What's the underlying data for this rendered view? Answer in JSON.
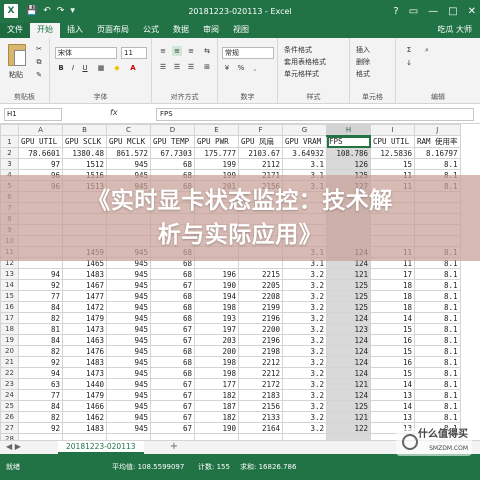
{
  "window": {
    "title": "20181223-020113 - Excel",
    "quick_access": [
      "💾",
      "↶",
      "↷",
      "▾"
    ],
    "controls": [
      "?",
      "▭",
      "—",
      "□",
      "✕"
    ]
  },
  "ribbon_tabs": [
    "文件",
    "开始",
    "插入",
    "页面布局",
    "公式",
    "数据",
    "审阅",
    "视图"
  ],
  "ribbon_active_tab": "开始",
  "user": "吃瓜 大师",
  "ribbon": {
    "clipboard": {
      "paste": "粘贴",
      "label": "剪贴板"
    },
    "font": {
      "name": "宋体",
      "size": "11",
      "label": "字体",
      "bold": "B",
      "italic": "I",
      "underline": "U",
      "grow": "A",
      "shrink": "A"
    },
    "alignment": {
      "label": "对齐方式"
    },
    "number": {
      "format": "常规",
      "label": "数字",
      "percent": "%",
      "comma": ","
    },
    "styles": {
      "conditional": "条件格式",
      "table": "套用表格格式",
      "cell": "单元格样式",
      "label": "样式"
    },
    "cells": {
      "insert": "插入",
      "delete": "删除",
      "format": "格式",
      "label": "单元格"
    },
    "editing": {
      "label": "编辑",
      "sum": "Σ",
      "sort": "↓"
    }
  },
  "formula_bar": {
    "name_box": "H1",
    "fx": "fx",
    "content": "FPS"
  },
  "grid": {
    "columns": [
      "A",
      "B",
      "C",
      "D",
      "E",
      "F",
      "G",
      "H",
      "I",
      "J"
    ],
    "selected_column": "H",
    "active_cell": "H1",
    "rows": [
      [
        "1",
        "GPU UTIL",
        "GPU SCLK",
        "GPU MCLK",
        "GPU TEMP",
        "GPU PWR",
        "GPU 风扇",
        "GPU VRAM",
        "FPS",
        "CPU UTIL",
        "RAM 使用率"
      ],
      [
        "2",
        "78.6601",
        "1380.48",
        "861.572",
        "67.7303",
        "175.777",
        "2103.67",
        "3.64932",
        "108.786",
        "12.5836",
        "8.16797"
      ],
      [
        "3",
        "97",
        "1512",
        "945",
        "68",
        "199",
        "2112",
        "3.1",
        "126",
        "15",
        "8.1"
      ],
      [
        "4",
        "96",
        "1516",
        "945",
        "68",
        "199",
        "2171",
        "3.1",
        "125",
        "11",
        "8.1"
      ],
      [
        "5",
        "96",
        "1513",
        "945",
        "68",
        "201",
        "2156",
        "3.1",
        "127",
        "11",
        "8.1"
      ],
      [
        "6",
        "",
        "",
        "",
        "",
        "",
        "",
        "",
        "",
        "",
        ""
      ],
      [
        "7",
        "",
        "",
        "",
        "",
        "",
        "",
        "",
        "",
        "",
        ""
      ],
      [
        "8",
        "",
        "",
        "",
        "",
        "",
        "",
        "",
        "",
        "",
        ""
      ],
      [
        "9",
        "",
        "",
        "",
        "",
        "",
        "",
        "",
        "",
        "",
        ""
      ],
      [
        "10",
        "",
        "",
        "",
        "",
        "",
        "",
        "",
        "",
        "",
        ""
      ],
      [
        "11",
        "",
        "1459",
        "945",
        "68",
        "",
        "",
        "3.1",
        "124",
        "11",
        "8.1"
      ],
      [
        "12",
        "",
        "1465",
        "945",
        "68",
        "",
        "",
        "3.1",
        "124",
        "11",
        "8.1"
      ],
      [
        "13",
        "94",
        "1483",
        "945",
        "68",
        "196",
        "2215",
        "3.2",
        "121",
        "17",
        "8.1"
      ],
      [
        "14",
        "92",
        "1467",
        "945",
        "67",
        "190",
        "2205",
        "3.2",
        "125",
        "18",
        "8.1"
      ],
      [
        "15",
        "77",
        "1477",
        "945",
        "68",
        "194",
        "2208",
        "3.2",
        "125",
        "18",
        "8.1"
      ],
      [
        "16",
        "84",
        "1472",
        "945",
        "68",
        "198",
        "2199",
        "3.2",
        "125",
        "18",
        "8.1"
      ],
      [
        "17",
        "82",
        "1479",
        "945",
        "68",
        "193",
        "2196",
        "3.2",
        "124",
        "14",
        "8.1"
      ],
      [
        "18",
        "81",
        "1473",
        "945",
        "67",
        "197",
        "2200",
        "3.2",
        "123",
        "15",
        "8.1"
      ],
      [
        "19",
        "84",
        "1463",
        "945",
        "67",
        "203",
        "2196",
        "3.2",
        "124",
        "16",
        "8.1"
      ],
      [
        "20",
        "82",
        "1476",
        "945",
        "68",
        "200",
        "2198",
        "3.2",
        "124",
        "15",
        "8.1"
      ],
      [
        "21",
        "92",
        "1483",
        "945",
        "68",
        "198",
        "2212",
        "3.2",
        "124",
        "16",
        "8.1"
      ],
      [
        "22",
        "94",
        "1473",
        "945",
        "68",
        "198",
        "2212",
        "3.2",
        "124",
        "15",
        "8.1"
      ],
      [
        "23",
        "63",
        "1440",
        "945",
        "67",
        "177",
        "2172",
        "3.2",
        "121",
        "14",
        "8.1"
      ],
      [
        "24",
        "77",
        "1479",
        "945",
        "67",
        "182",
        "2183",
        "3.2",
        "124",
        "13",
        "8.1"
      ],
      [
        "25",
        "84",
        "1466",
        "945",
        "67",
        "187",
        "2156",
        "3.2",
        "125",
        "14",
        "8.1"
      ],
      [
        "26",
        "82",
        "1462",
        "945",
        "67",
        "182",
        "2133",
        "3.2",
        "121",
        "13",
        "8.1"
      ],
      [
        "27",
        "92",
        "1483",
        "945",
        "67",
        "190",
        "2164",
        "3.2",
        "122",
        "13",
        "8.1"
      ],
      [
        "28",
        "",
        "",
        "",
        "",
        "",
        "",
        "",
        "",
        "",
        ""
      ]
    ]
  },
  "banner": {
    "line1": "《实时显卡状态监控：技术解",
    "line2": "析与实际应用》"
  },
  "sheet_tabs": {
    "nav": "◀ ▶",
    "active": "20181223-020113",
    "add": "+"
  },
  "status": {
    "ready": "就绪",
    "average": "平均值: 108.5599097",
    "count": "计数: 155",
    "sum": "求和: 16826.786"
  },
  "watermark": {
    "text": "什么值得买",
    "sub": "SMZDM.COM"
  }
}
